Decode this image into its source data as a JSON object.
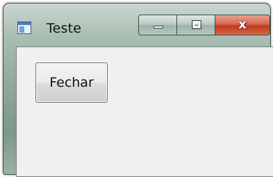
{
  "window": {
    "title": "Teste",
    "icon": "window-app-icon",
    "controls": {
      "minimize_icon": "minimize-icon",
      "maximize_icon": "maximize-icon",
      "close_icon": "close-icon",
      "close_glyph": "x",
      "close_color": "#c1391d"
    }
  },
  "client": {
    "close_button_label": "Fechar"
  }
}
